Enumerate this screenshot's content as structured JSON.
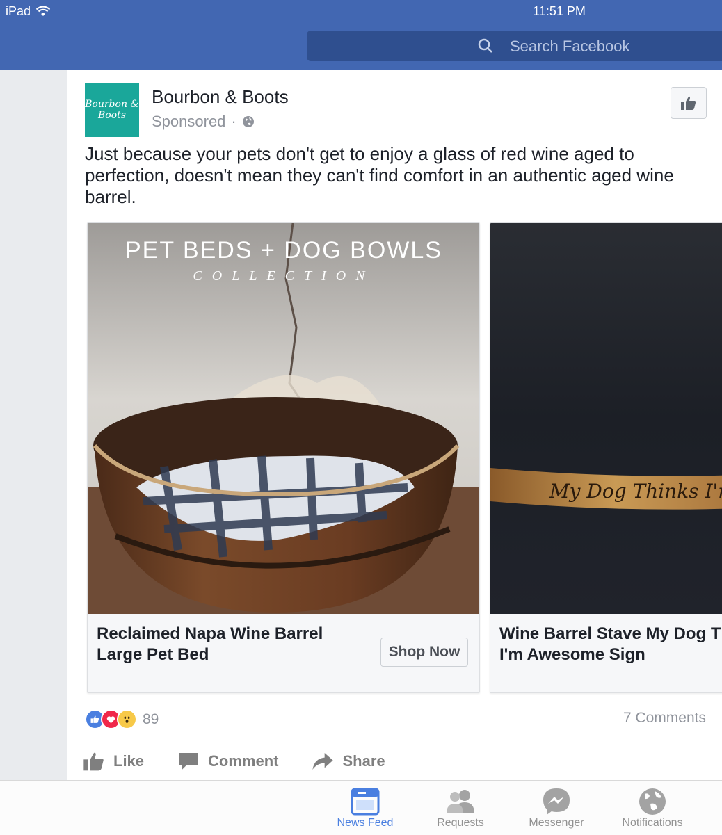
{
  "status_bar": {
    "carrier": "iPad",
    "time": "11:51 PM"
  },
  "search": {
    "placeholder": "Search Facebook"
  },
  "post": {
    "page_name": "Bourbon & Boots",
    "logo_text": "Bourbon & Boots",
    "sponsored": "Sponsored",
    "separator": "·",
    "text": "Just because your pets don't get to enjoy a glass of red wine aged to perfection, doesn't mean they can't find comfort in an authentic aged wine barrel."
  },
  "carousel": [
    {
      "image_title": "PET BEDS + DOG BOWLS",
      "image_subtitle": "COLLECTION",
      "title": "Reclaimed Napa Wine Barrel\nLarge Pet Bed",
      "cta": "Shop Now"
    },
    {
      "image_text": "My Dog Thinks I'm",
      "title": "Wine Barrel Stave My Dog T\nI'm Awesome Sign"
    }
  ],
  "engagement": {
    "reaction_count": "89",
    "comments": "7 Comments"
  },
  "actions": {
    "like": "Like",
    "comment": "Comment",
    "share": "Share"
  },
  "tabs": [
    {
      "label": "News Feed",
      "icon": "news-feed-icon"
    },
    {
      "label": "Requests",
      "icon": "requests-icon"
    },
    {
      "label": "Messenger",
      "icon": "messenger-icon"
    },
    {
      "label": "Notifications",
      "icon": "globe-icon"
    }
  ],
  "colors": {
    "brand": "#4267b2",
    "logo_bg": "#1aa79a",
    "active_tab": "#4a7fe0"
  }
}
